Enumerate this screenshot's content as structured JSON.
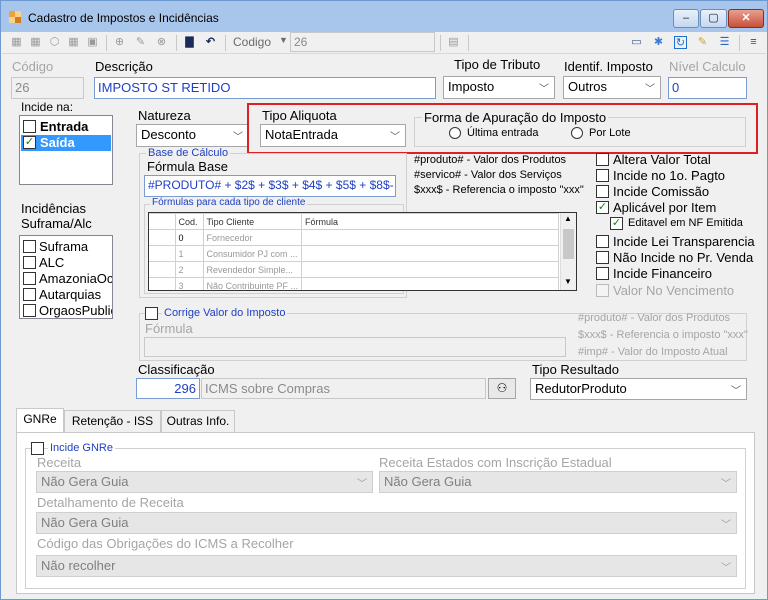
{
  "window": {
    "title": "Cadastro de Impostos e Incidências",
    "controls": [
      "–",
      "▢",
      "✕"
    ]
  },
  "toolbar": {
    "codigo_label": "Codigo",
    "codigo_value": "26"
  },
  "form": {
    "codigo_label": "Código",
    "codigo_value": "26",
    "descricao_label": "Descrição",
    "descricao_value": "IMPOSTO ST RETIDO",
    "tipo_tributo_label": "Tipo de Tributo",
    "tipo_tributo_value": "Imposto",
    "identif_label": "Identif. Imposto",
    "identif_value": "Outros",
    "nivel_label": "Nível Calculo",
    "nivel_value": "0"
  },
  "incide": {
    "label": "Incide na:",
    "items": [
      {
        "label": "Entrada",
        "checked": false
      },
      {
        "label": "Saída",
        "checked": true
      }
    ]
  },
  "natureza": {
    "label": "Natureza",
    "value": "Desconto"
  },
  "tipo_aliquota": {
    "label": "Tipo Aliquota",
    "value": "NotaEntrada"
  },
  "forma_apuracao": {
    "label": "Forma de Apuração do Imposto",
    "options": [
      {
        "label": "Última entrada",
        "selected": false
      },
      {
        "label": "Por Lote",
        "selected": false
      }
    ]
  },
  "base_calculo": {
    "group_label": "Base de Cálculo",
    "formula_label": "Fórmula Base",
    "formula_value": "#PRODUTO# + $2$ + $3$ + $4$ + $5$ + $8$-",
    "formulas_label": "Fórmulas para cada tipo de cliente",
    "columns": [
      "Cod.",
      "Tipo Cliente",
      "Fórmula"
    ],
    "rows": [
      {
        "cod": "0",
        "tipo": "Fornecedor",
        "formula": ""
      },
      {
        "cod": "1",
        "tipo": "Consumidor PJ com ...",
        "formula": ""
      },
      {
        "cod": "2",
        "tipo": "Revendedor Simple...",
        "formula": ""
      },
      {
        "cod": "3",
        "tipo": "Não Contribuinte PF ...",
        "formula": ""
      }
    ]
  },
  "hints_top": [
    "#produto# - Valor dos Produtos",
    "#servico# - Valor dos Serviços",
    "$xxx$ - Referencia o imposto \"xxx\""
  ],
  "incidencias": {
    "label1": "Incidências",
    "label2": "Suframa/Alc",
    "items": [
      "Suframa",
      "ALC",
      "AmazoniaOc",
      "Autarquias",
      "OrgaosPublic"
    ]
  },
  "options": [
    {
      "label": "Altera Valor Total",
      "checked": false,
      "disabled": false
    },
    {
      "label": "Incide no 1o. Pagto",
      "checked": false,
      "disabled": false
    },
    {
      "label": "Incide Comissão",
      "checked": false,
      "disabled": false
    },
    {
      "label": "Aplicável por Item",
      "checked": true,
      "disabled": false
    },
    {
      "label": "Editavel em NF Emitida",
      "checked": true,
      "disabled": false
    },
    {
      "label": "Incide Lei Transparencia",
      "checked": false,
      "disabled": false
    },
    {
      "label": "Não Incide no Pr. Venda",
      "checked": false,
      "disabled": false
    },
    {
      "label": "Incide Financeiro",
      "checked": false,
      "disabled": false
    },
    {
      "label": "Valor No Vencimento",
      "checked": false,
      "disabled": true
    }
  ],
  "corrige": {
    "label": "Corrige Valor do Imposto",
    "formula_label": "Fórmula",
    "hints": [
      "#produto# - Valor dos Produtos",
      "$xxx$ - Referencia o imposto \"xxx\"",
      "#imp# - Valor do Imposto Atual"
    ]
  },
  "classificacao": {
    "label": "Classificação",
    "code": "296",
    "desc": "ICMS sobre Compras"
  },
  "tipo_resultado": {
    "label": "Tipo Resultado",
    "value": "RedutorProduto"
  },
  "tabs": [
    "GNRe",
    "Retenção - ISS",
    "Outras Info."
  ],
  "gnre": {
    "incide_label": "Incide GNRe",
    "receita_label": "Receita",
    "receita_value": "Não Gera Guia",
    "receita_estados_label": "Receita Estados com Inscrição Estadual",
    "receita_estados_value": "Não Gera Guia",
    "detalhamento_label": "Detalhamento de Receita",
    "detalhamento_value": "Não Gera Guia",
    "codigo_obrig_label": "Código das Obrigações do ICMS a Recolher",
    "codigo_obrig_value": "Não recolher"
  },
  "highlight_color": "#e02020"
}
